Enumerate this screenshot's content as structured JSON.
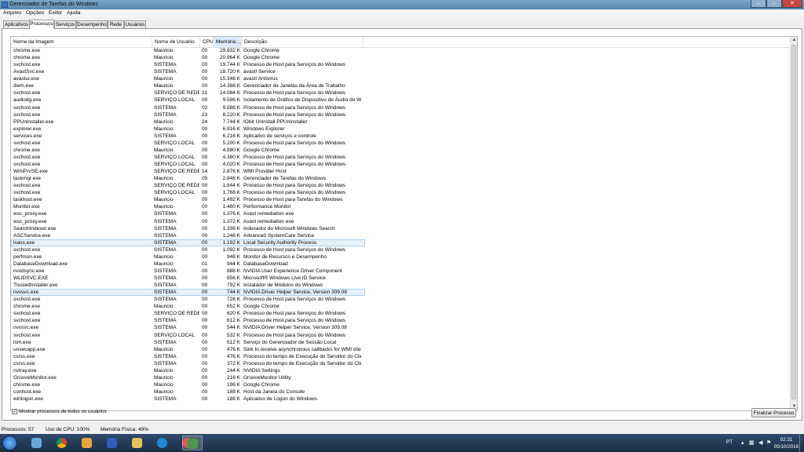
{
  "window": {
    "title": "Gerenciador de Tarefas do Windows"
  },
  "menu": [
    "Arquivo",
    "Opções",
    "Exibir",
    "Ajuda"
  ],
  "tabs": [
    "Aplicativos",
    "Processos",
    "Serviços",
    "Desempenho",
    "Rede",
    "Usuários"
  ],
  "active_tab": "Processos",
  "columns": [
    "Nome da Imagem",
    "Nome de Usuário",
    "CPU",
    "Memória ...",
    "Descrição"
  ],
  "processes": [
    [
      "chrome.exe",
      "Mauricio",
      "00",
      "29.832 K",
      "Google Chrome"
    ],
    [
      "chrome.exe",
      "Mauricio",
      "00",
      "20.964 K",
      "Google Chrome"
    ],
    [
      "svchost.exe",
      "SISTEMA",
      "00",
      "19.744 K",
      "Processo de Host para Serviços do Windows"
    ],
    [
      "AvastSvc.exe",
      "SISTEMA",
      "00",
      "18.720 K",
      "avast! Service"
    ],
    [
      "avastui.exe",
      "Mauricio",
      "00",
      "15.348 K",
      "avast! Antivirus"
    ],
    [
      "dwm.exe",
      "Mauricio",
      "00",
      "14.368 K",
      "Gerenciador de Janelas da Área de Trabalho"
    ],
    [
      "svchost.exe",
      "SERVIÇO DE REDE",
      "31",
      "14.084 K",
      "Processo de Host para Serviços do Windows"
    ],
    [
      "audiodg.exe",
      "SERVIÇO LOCAL",
      "00",
      "9.596 K",
      "Isolamento de Gráfico de Dispositivo de Áudio do Windo..."
    ],
    [
      "svchost.exe",
      "SISTEMA",
      "02",
      "9.588 K",
      "Processo de Host para Serviços do Windows"
    ],
    [
      "svchost.exe",
      "SISTEMA",
      "23",
      "8.220 K",
      "Processo de Host para Serviços do Windows"
    ],
    [
      "PPUninstaller.exe",
      "Mauricio",
      "24",
      "7.744 K",
      "IObit Uninstall PPUninstaller"
    ],
    [
      "explorer.exe",
      "Mauricio",
      "00",
      "6.916 K",
      "Windows Explorer"
    ],
    [
      "services.exe",
      "SISTEMA",
      "00",
      "6.216 K",
      "Aplicativo de serviços e controle"
    ],
    [
      "svchost.exe",
      "SERVIÇO LOCAL",
      "00",
      "5.200 K",
      "Processo de Host para Serviços do Windows"
    ],
    [
      "chrome.exe",
      "Mauricio",
      "00",
      "4.980 K",
      "Google Chrome"
    ],
    [
      "svchost.exe",
      "SERVIÇO LOCAL",
      "00",
      "4.360 K",
      "Processo de Host para Serviços do Windows"
    ],
    [
      "svchost.exe",
      "SERVIÇO LOCAL",
      "00",
      "4.020 K",
      "Processo de Host para Serviços do Windows"
    ],
    [
      "WmiPrvSE.exe",
      "SERVIÇO DE REDE",
      "14",
      "2.876 K",
      "WMI Provider Host"
    ],
    [
      "taskmgr.exe",
      "Mauricio",
      "05",
      "2.848 K",
      "Gerenciador de Tarefas do Windows"
    ],
    [
      "svchost.exe",
      "SERVIÇO DE REDE",
      "00",
      "1.844 K",
      "Processo de Host para Serviços do Windows"
    ],
    [
      "svchost.exe",
      "SERVIÇO LOCAL",
      "00",
      "1.768 K",
      "Processo de Host para Serviços do Windows"
    ],
    [
      "taskhost.exe",
      "Mauricio",
      "00",
      "1.492 K",
      "Processo de Host para Tarefas do Windows"
    ],
    [
      "Monitor.exe",
      "Mauricio",
      "00",
      "1.480 K",
      "Performance Monitor"
    ],
    [
      "wsc_proxy.exe",
      "SISTEMA",
      "00",
      "1.376 K",
      "Avast remediation exe"
    ],
    [
      "wsc_proxy.exe",
      "SISTEMA",
      "00",
      "1.372 K",
      "Avast remediation exe"
    ],
    [
      "SearchIndexer.exe",
      "SISTEMA",
      "00",
      "1.336 K",
      "Indexador do Microsoft Windows Search"
    ],
    [
      "ASCService.exe",
      "SISTEMA",
      "00",
      "1.248 K",
      "Advanced SystemCare Service"
    ],
    [
      "lsass.exe",
      "SISTEMA",
      "00",
      "1.192 K",
      "Local Security Authority Process"
    ],
    [
      "svchost.exe",
      "SISTEMA",
      "00",
      "1.092 K",
      "Processo de Host para Serviços do Windows"
    ],
    [
      "perfmon.exe",
      "Mauricio",
      "00",
      "948 K",
      "Monitor de Recursos e Desempenho"
    ],
    [
      "DatabaseDownload.exe",
      "Mauricio",
      "01",
      "944 K",
      "DatabaseDownload"
    ],
    [
      "nvxdsync.exe",
      "SISTEMA",
      "00",
      "888 K",
      "NVIDIA User Experience Driver Component"
    ],
    [
      "WLIDSVC.EXE",
      "SISTEMA",
      "00",
      "856 K",
      "Microsoft® Windows Live ID Service"
    ],
    [
      "TrustedInstaller.exe",
      "SISTEMA",
      "00",
      "792 K",
      "Instalador de Módulos do Windows"
    ],
    [
      "nvvsvc.exe",
      "SISTEMA",
      "00",
      "744 K",
      "NVIDIA Driver Helper Service, Version 309.08"
    ],
    [
      "svchost.exe",
      "SISTEMA",
      "00",
      "728 K",
      "Processo de Host para Serviços do Windows"
    ],
    [
      "chrome.exe",
      "Mauricio",
      "00",
      "652 K",
      "Google Chrome"
    ],
    [
      "svchost.exe",
      "SERVIÇO DE REDE",
      "00",
      "620 K",
      "Processo de Host para Serviços do Windows"
    ],
    [
      "svchost.exe",
      "SISTEMA",
      "00",
      "612 K",
      "Processo de Host para Serviços do Windows"
    ],
    [
      "nvvsvc.exe",
      "SISTEMA",
      "00",
      "544 K",
      "NVIDIA Driver Helper Service, Version 309.08"
    ],
    [
      "svchost.exe",
      "SERVIÇO LOCAL",
      "00",
      "532 K",
      "Processo de Host para Serviços do Windows"
    ],
    [
      "lsm.exe",
      "SISTEMA",
      "00",
      "512 K",
      "Serviço do Gerenciador de Sessão Local"
    ],
    [
      "unsecapp.exe",
      "Mauricio",
      "00",
      "476 K",
      "Sink to receive asynchronous callbacks for WMI client ..."
    ],
    [
      "csrss.exe",
      "SISTEMA",
      "00",
      "476 K",
      "Processo do tempo de Execução do Servidor do Cliente"
    ],
    [
      "csrss.exe",
      "SISTEMA",
      "00",
      "372 K",
      "Processo do tempo de Execução do Servidor do Cliente"
    ],
    [
      "nvtray.exe",
      "Mauricio",
      "00",
      "244 K",
      "NVIDIA Settings"
    ],
    [
      "GrooveMonitor.exe",
      "Mauricio",
      "00",
      "216 K",
      "GrooveMonitor Utility"
    ],
    [
      "chrome.exe",
      "Mauricio",
      "00",
      "196 K",
      "Google Chrome"
    ],
    [
      "conhost.exe",
      "Mauricio",
      "00",
      "188 K",
      "Host da Janela do Console"
    ],
    [
      "winlogon.exe",
      "SISTEMA",
      "00",
      "188 K",
      "Aplicativo de Logon do Windows"
    ]
  ],
  "selected_rows": [
    27
  ],
  "hover_rows": [
    34
  ],
  "show_all_label": "Mostrar processos de todos os usuários",
  "show_all_checked": true,
  "end_process_label": "Finalizar Processo",
  "status": {
    "processes": "Processos: 57",
    "cpu": "Uso de CPU: 100%",
    "memory": "Memória Física: 49%"
  },
  "taskbar": {
    "language": "PT",
    "time": "02:31",
    "date": "05/10/2016",
    "apps": [
      "windows-explorer-icon",
      "chrome-icon",
      "media-player-icon",
      "winamp-icon",
      "folder-icon",
      "iobit-icon",
      "avast-icon",
      "task-manager-icon"
    ]
  },
  "colors": {
    "selection": "#e5f1fb",
    "titlebar": "#6b94b9",
    "taskbar": "#24405f"
  }
}
